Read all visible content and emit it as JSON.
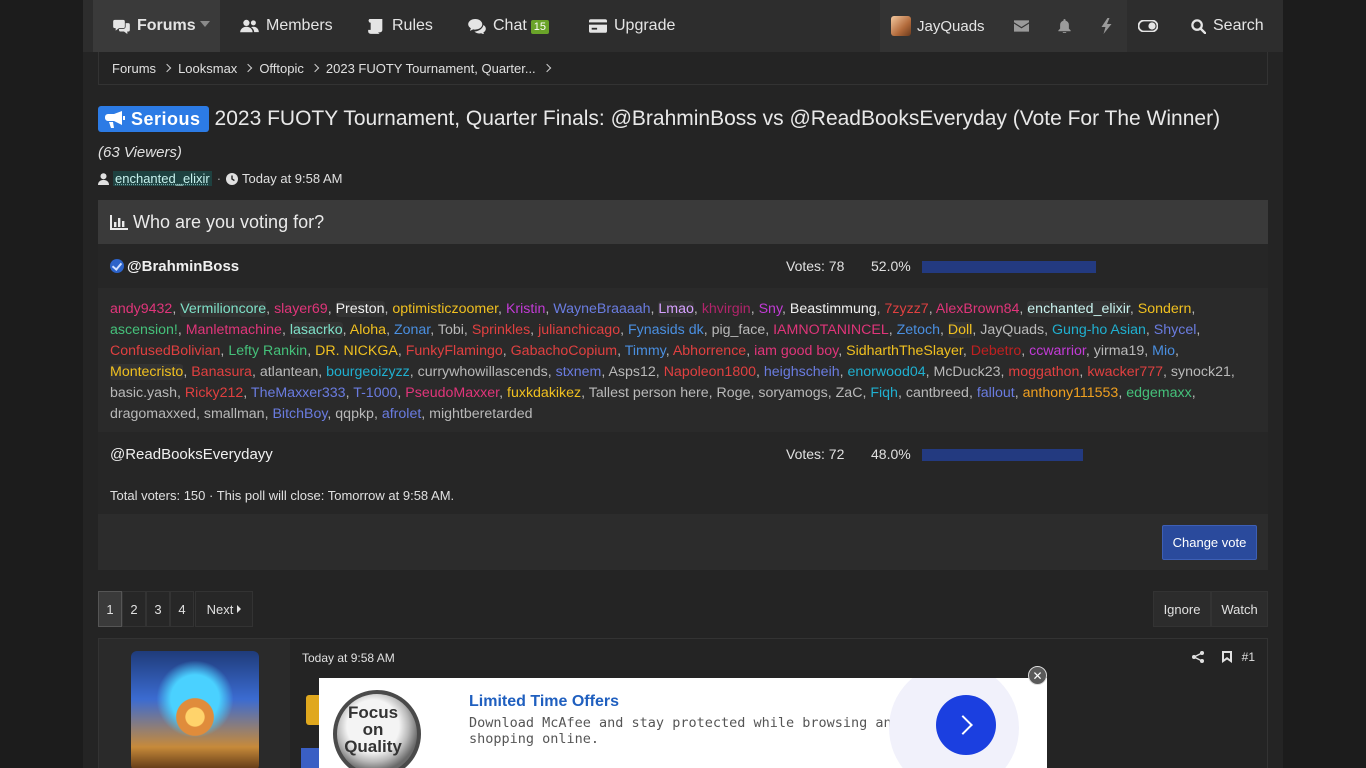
{
  "nav": {
    "forums": "Forums",
    "members": "Members",
    "rules": "Rules",
    "chat": "Chat",
    "chat_badge": "15",
    "upgrade": "Upgrade",
    "username": "JayQuads",
    "search": "Search"
  },
  "breadcrumb": [
    "Forums",
    "Looksmax",
    "Offtopic",
    "2023 FUOTY Tournament, Quarter..."
  ],
  "thread": {
    "prefix": "Serious",
    "title": "2023 FUOTY Tournament, Quarter Finals: @BrahminBoss vs @ReadBooksEveryday (Vote For The Winner)",
    "viewers": "(63 Viewers)",
    "author": "enchanted_elixir",
    "sep": "·",
    "time": "Today at 9:58 AM"
  },
  "poll": {
    "question": "Who are you voting for?",
    "options": [
      {
        "name": "@BrahminBoss",
        "votes": "Votes: 78",
        "percent": "52.0%",
        "fraction": 0.52,
        "voted": true
      },
      {
        "name": "@ReadBooksEverydayy",
        "votes": "Votes: 72",
        "percent": "48.0%",
        "fraction": 0.48,
        "voted": false
      }
    ],
    "voters": [
      {
        "n": "andy9432",
        "c": "#e0357a"
      },
      {
        "n": "Vermilioncore",
        "c": "#7fe0c8",
        "hl": true
      },
      {
        "n": "slayer69",
        "c": "#e0357a"
      },
      {
        "n": "Preston",
        "c": "#f0f0f0",
        "hl": true
      },
      {
        "n": "optimisticzoomer",
        "c": "#f0c020"
      },
      {
        "n": "Kristin",
        "c": "#c23bd6"
      },
      {
        "n": "WayneBraaaah",
        "c": "#6a7ce0"
      },
      {
        "n": "Lmao",
        "c": "#d6a0ff",
        "hl": true
      },
      {
        "n": "khvirgin",
        "c": "#b0246a"
      },
      {
        "n": "Sny",
        "c": "#c23bd6"
      },
      {
        "n": "Beastimmung",
        "c": "#f0f0f0"
      },
      {
        "n": "7zyzz7",
        "c": "#e04040"
      },
      {
        "n": "AlexBrown84",
        "c": "#e0357a"
      },
      {
        "n": "enchanted_elixir",
        "c": "#c8f2ee",
        "hl": true
      },
      {
        "n": "Sondern",
        "c": "#f0c020"
      },
      {
        "n": "ascension!",
        "c": "#45c07a"
      },
      {
        "n": "Manletmachine",
        "c": "#e0357a"
      },
      {
        "n": "lasacrko",
        "c": "#7fe0c8",
        "hl": true
      },
      {
        "n": "Aloha",
        "c": "#f0c020"
      },
      {
        "n": "Zonar",
        "c": "#4a8fe0"
      },
      {
        "n": "Tobi",
        "c": "#b9b9b9"
      },
      {
        "n": "Sprinkles",
        "c": "#e04040"
      },
      {
        "n": "julianchicago",
        "c": "#e04040"
      },
      {
        "n": "Fynasids dk",
        "c": "#4a8fe0"
      },
      {
        "n": "pig_face",
        "c": "#b9b9b9"
      },
      {
        "n": "IAMNOTANINCEL",
        "c": "#e0357a"
      },
      {
        "n": "Zetoch",
        "c": "#4a8fe0"
      },
      {
        "n": "Doll",
        "c": "#f0c020",
        "hl": true
      },
      {
        "n": "JayQuads",
        "c": "#b9b9b9"
      },
      {
        "n": "Gung-ho Asian",
        "c": "#20b0d0"
      },
      {
        "n": "Shycel",
        "c": "#6a7ce0"
      },
      {
        "n": "ConfusedBolivian",
        "c": "#e04040"
      },
      {
        "n": "Lefty Rankin",
        "c": "#45c07a"
      },
      {
        "n": "DR. NICKGA",
        "c": "#f0c020"
      },
      {
        "n": "FunkyFlamingo",
        "c": "#e04040"
      },
      {
        "n": "GabachoCopium",
        "c": "#e04040"
      },
      {
        "n": "Timmy",
        "c": "#4a8fe0"
      },
      {
        "n": "Abhorrence",
        "c": "#e04040"
      },
      {
        "n": "iam good boy",
        "c": "#e0357a"
      },
      {
        "n": "SidharthTheSlayer",
        "c": "#f0c020"
      },
      {
        "n": "Debetro",
        "c": "#c02020"
      },
      {
        "n": "ccwarrior",
        "c": "#c23bd6"
      },
      {
        "n": "yirma19",
        "c": "#b9b9b9"
      },
      {
        "n": "Mio",
        "c": "#4a8fe0"
      },
      {
        "n": "Montecristo",
        "c": "#f0c020",
        "hl": true
      },
      {
        "n": "Banasura",
        "c": "#e04040"
      },
      {
        "n": "atlantean",
        "c": "#b9b9b9"
      },
      {
        "n": "bourgeoizyzz",
        "c": "#20b0d0"
      },
      {
        "n": "currywhowillascends",
        "c": "#b9b9b9"
      },
      {
        "n": "stxnem",
        "c": "#6a7ce0"
      },
      {
        "n": "Asps12",
        "c": "#b9b9b9"
      },
      {
        "n": "Napoleon1800",
        "c": "#e04040"
      },
      {
        "n": "heighscheih",
        "c": "#6a7ce0"
      },
      {
        "n": "enorwood04",
        "c": "#20b0d0"
      },
      {
        "n": "McDuck23",
        "c": "#b9b9b9"
      },
      {
        "n": "moggathon",
        "c": "#e04040"
      },
      {
        "n": "kwacker777",
        "c": "#e04040"
      },
      {
        "n": "synock21",
        "c": "#b9b9b9"
      },
      {
        "n": "basic.yash",
        "c": "#b9b9b9"
      },
      {
        "n": "Ricky212",
        "c": "#e04040"
      },
      {
        "n": "TheMaxxer333",
        "c": "#6a7ce0"
      },
      {
        "n": "T-1000",
        "c": "#6a7ce0"
      },
      {
        "n": "PseudoMaxxer",
        "c": "#e0357a"
      },
      {
        "n": "fuxkdakikez",
        "c": "#f0c020"
      },
      {
        "n": "Tallest person here",
        "c": "#b9b9b9"
      },
      {
        "n": "Roge",
        "c": "#b9b9b9"
      },
      {
        "n": "soryamogs",
        "c": "#b9b9b9"
      },
      {
        "n": "ZaC",
        "c": "#b9b9b9"
      },
      {
        "n": "Fiqh",
        "c": "#20b0d0"
      },
      {
        "n": "cantbreed",
        "c": "#b9b9b9"
      },
      {
        "n": "fallout",
        "c": "#6a7ce0"
      },
      {
        "n": "anthony111553",
        "c": "#f0a020"
      },
      {
        "n": "edgemaxx",
        "c": "#45c07a"
      },
      {
        "n": "dragomaxxed",
        "c": "#b9b9b9"
      },
      {
        "n": "smallman",
        "c": "#b9b9b9"
      },
      {
        "n": "BitchBoy",
        "c": "#6a7ce0"
      },
      {
        "n": "qqpkp",
        "c": "#b9b9b9"
      },
      {
        "n": "afrolet",
        "c": "#6a7ce0"
      },
      {
        "n": "mightberetarded",
        "c": "#b9b9b9"
      }
    ],
    "total": "Total voters: 150 · This poll will close: Tomorrow at 9:58 AM.",
    "change_vote": "Change vote"
  },
  "pagination": {
    "pages": [
      "1",
      "2",
      "3",
      "4"
    ],
    "current": "1",
    "next": "Next"
  },
  "thread_actions": {
    "ignore": "Ignore",
    "watch": "Watch"
  },
  "post": {
    "time": "Today at 9:58 AM",
    "number": "#1"
  },
  "ad": {
    "logo_text": "Focus on Quality",
    "title": "Limited Time Offers",
    "description": "Download McAfee and stay protected while browsing and shopping online.",
    "close": "✕"
  },
  "colors": {
    "accent": "#2c7be5",
    "bar": "#233a80",
    "button": "#2a4a9c"
  }
}
